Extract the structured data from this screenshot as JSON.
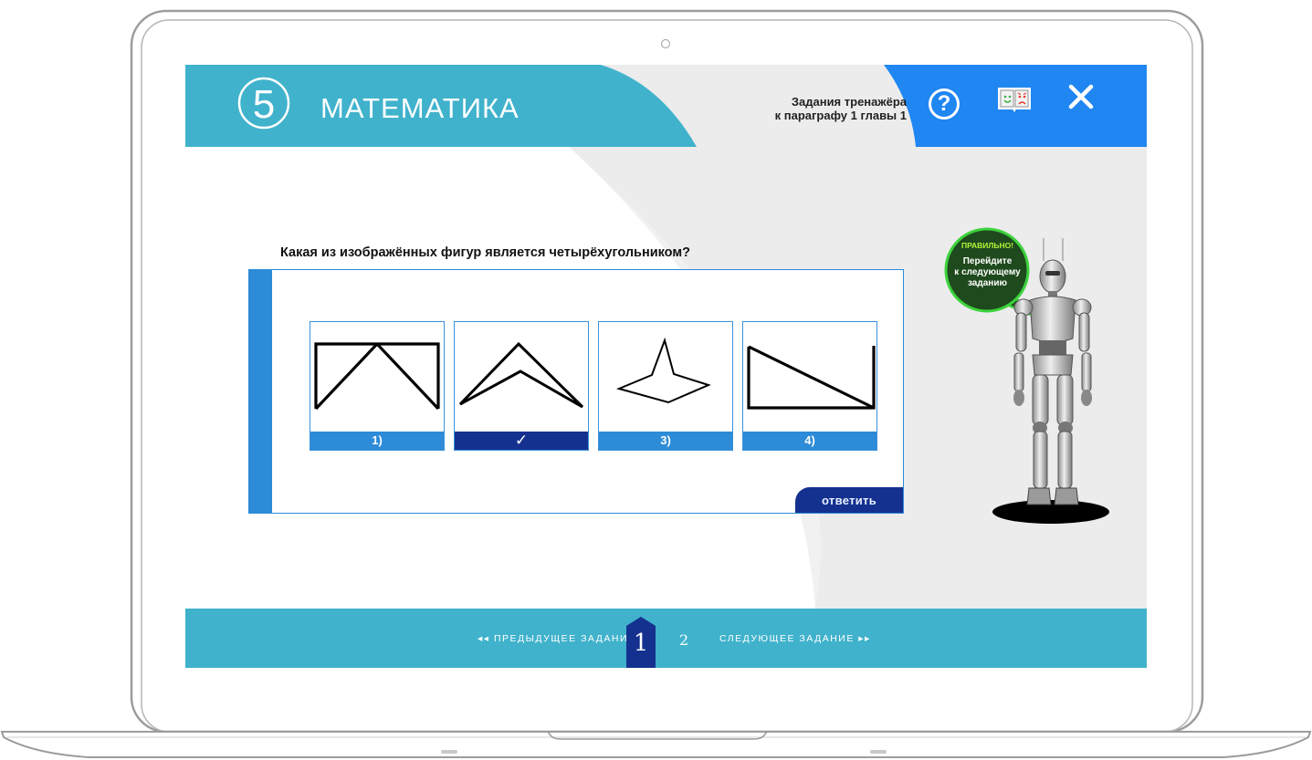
{
  "app": {
    "logo_number": "5",
    "title": "МАТЕМАТИКА"
  },
  "task": {
    "line1": "Задания тренажёра",
    "line2": "к параграфу 1 главы 1"
  },
  "toolbar": {
    "help_icon": "question-circle-icon",
    "help_symbol": "?",
    "book_icon": "book-smiley-icon",
    "close_icon": "close-icon",
    "close_symbol": "✕"
  },
  "question": {
    "text": "Какая из изображённых фигур является четырёхугольником?"
  },
  "options": [
    {
      "label": "1)",
      "selected": false
    },
    {
      "label": "✓",
      "selected": true
    },
    {
      "label": "3)",
      "selected": false
    },
    {
      "label": "4)",
      "selected": false
    }
  ],
  "answer_button": "ответить",
  "feedback": {
    "title": "ПРАВИЛЬНО!",
    "line1": "Перейдите",
    "line2": "к следующему",
    "line3": "заданию"
  },
  "pagination": {
    "prev": "◂◂  ПРЕДЫДУЩЕЕ ЗАДАНИЕ",
    "current": "1",
    "next_page": "2",
    "next": "СЛЕДУЮЩЕЕ ЗАДАНИЕ  ▸▸"
  },
  "colors": {
    "teal": "#40b2cc",
    "blue": "#2d8bd8",
    "bright_blue": "#1f86f2",
    "navy": "#15318f",
    "bubble_green": "#1f4a1d",
    "bubble_border": "#3cd23c"
  }
}
